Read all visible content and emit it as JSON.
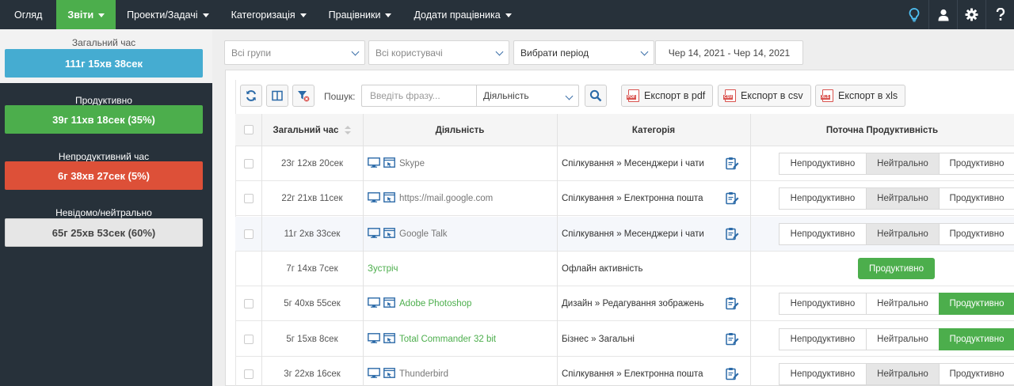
{
  "nav": {
    "items": [
      {
        "label": "Огляд",
        "dropdown": false,
        "active": false
      },
      {
        "label": "Звіти",
        "dropdown": true,
        "active": true
      },
      {
        "label": "Проекти/Задачі",
        "dropdown": true,
        "active": false
      },
      {
        "label": "Категоризація",
        "dropdown": true,
        "active": false
      },
      {
        "label": "Працівники",
        "dropdown": true,
        "active": false
      },
      {
        "label": "Додати працівника",
        "dropdown": true,
        "active": false
      }
    ],
    "right_icons": [
      "lightbulb-icon",
      "user-icon",
      "gear-icon",
      "question-icon"
    ]
  },
  "summary": {
    "total_label": "Загальний час",
    "total_value": "111г 15хв 38сек",
    "productive_label": "Продуктивно",
    "productive_value": "39г 11хв 18сек (35%)",
    "unproductive_label": "Непродуктивний час",
    "unproductive_value": "6г 38хв 27сек (5%)",
    "neutral_label": "Невідомо/нейтрально",
    "neutral_value": "65г 25хв 53сек (60%)"
  },
  "colors": {
    "nav_bg": "#27313a",
    "active_tab": "#4cae4c",
    "total": "#45acd1",
    "productive": "#4cae4c",
    "unproductive": "#dd5038",
    "neutral": "#e6e6e6"
  },
  "filters": {
    "groups": "Всі групи",
    "users": "Всі користувачі",
    "period": "Вибрати період",
    "date_range": "Чер 14, 2021 - Чер 14, 2021"
  },
  "toolbar": {
    "search_label": "Пошук:",
    "search_placeholder": "Введіть фразу...",
    "search_scope": "Діяльність",
    "export_pdf": "Експорт в pdf",
    "export_csv": "Експорт в csv",
    "export_xls": "Експорт в xls"
  },
  "table": {
    "headers": {
      "time": "Загальний час",
      "activity": "Діяльність",
      "category": "Категорія",
      "productivity": "Поточна Продуктивність"
    },
    "productivity_options": [
      "Непродуктивно",
      "Нейтрально",
      "Продуктивно"
    ],
    "rows": [
      {
        "time": "23г 12хв 20сек",
        "activity": "Skype",
        "category": "Спілкування » Месенджери і чати",
        "status": "Нейтрально",
        "offline": false,
        "checkbox": true
      },
      {
        "time": "22г 21хв 11сек",
        "activity": "https://mail.google.com",
        "category": "Спілкування » Електронна пошта",
        "status": "Нейтрально",
        "offline": false,
        "checkbox": true
      },
      {
        "time": "11г 2хв 33сек",
        "activity": "Google Talk",
        "category": "Спілкування » Месенджери і чати",
        "status": "Нейтрально",
        "offline": false,
        "checkbox": true
      },
      {
        "time": "7г 14хв 7сек",
        "activity": "Зустріч",
        "category": "Офлайн активність",
        "status": "Продуктивно",
        "offline": true,
        "checkbox": false
      },
      {
        "time": "5г 40хв 55сек",
        "activity": "Adobe Photoshop",
        "category": "Дизайн » Редагування зображень",
        "status": "Продуктивно",
        "offline": false,
        "checkbox": true
      },
      {
        "time": "5г 15хв 8сек",
        "activity": "Total Commander 32 bit",
        "category": "Бізнес » Загальні",
        "status": "Продуктивно",
        "offline": false,
        "checkbox": true
      },
      {
        "time": "3г 22хв 16сек",
        "activity": "Thunderbird",
        "category": "Спілкування » Електронна пошта",
        "status": "Нейтрально",
        "offline": false,
        "checkbox": true
      }
    ]
  }
}
